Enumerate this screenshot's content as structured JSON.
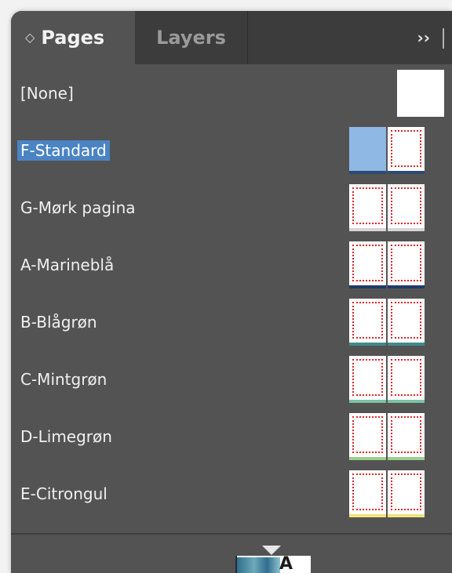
{
  "tabs": {
    "pages_label": "Pages",
    "layers_label": "Layers",
    "updown_glyph": "◇",
    "menu_glyph": "››"
  },
  "colors": {
    "panel_bg": "#535353",
    "tabbar_bg": "#3c3c3c",
    "selection": "#4a84c4",
    "margin_guide": "#e0232b"
  },
  "masters": [
    {
      "label": "[None]",
      "type": "none"
    },
    {
      "label": "F-Standard",
      "selected": true,
      "strip": "#2d4a73"
    },
    {
      "label": "G-Mørk pagina",
      "strip": "#d6d6d6"
    },
    {
      "label": "A-Marineblå",
      "strip": "#1f3a68"
    },
    {
      "label": "B-Blågrøn",
      "strip": "#3f8c8c"
    },
    {
      "label": "C-Mintgrøn",
      "strip": "#7cc2a5"
    },
    {
      "label": "D-Limegrøn",
      "strip": "#9ccf8f"
    },
    {
      "label": "E-Citrongul",
      "strip": "#f1e37a"
    }
  ],
  "footer": {
    "thumb_letter": "A"
  }
}
